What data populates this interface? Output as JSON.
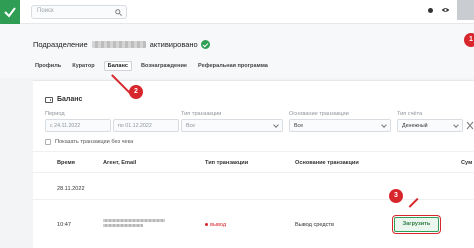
{
  "topbar": {
    "search_placeholder": "Поиск"
  },
  "header": {
    "title_prefix": "Подразделение",
    "title_suffix": "активировано",
    "tabs": [
      "Профиль",
      "Куратор",
      "Баланс",
      "Вознаграждение",
      "Реферальная программа"
    ],
    "active_tab": "Баланс"
  },
  "badges": {
    "b1": "1",
    "b2": "2",
    "b3": "3"
  },
  "balance": {
    "title": "Баланс",
    "filters": {
      "period_label": "Период",
      "date_from": "24.11.2022",
      "date_to": "01.12.2022",
      "type_label": "Тип транзакции",
      "type_value": "Все",
      "basis_label": "Основание транзакции",
      "basis_value": "Все",
      "account_label": "Тип счёта",
      "account_value": "Денежный"
    },
    "show_without_check": "Показать транзакции без чека",
    "columns": [
      "Время",
      "Агент, Email",
      "Тип транзакции",
      "Основание транзакции",
      "Сум"
    ],
    "group_date": "28.11.2022",
    "rows": [
      {
        "time": "10:47",
        "type": "вывод",
        "basis": "Вывод средств",
        "action": "Загрузить"
      }
    ]
  },
  "colors": {
    "brand_green": "#2f9e54",
    "alert_red": "#d7262c"
  }
}
